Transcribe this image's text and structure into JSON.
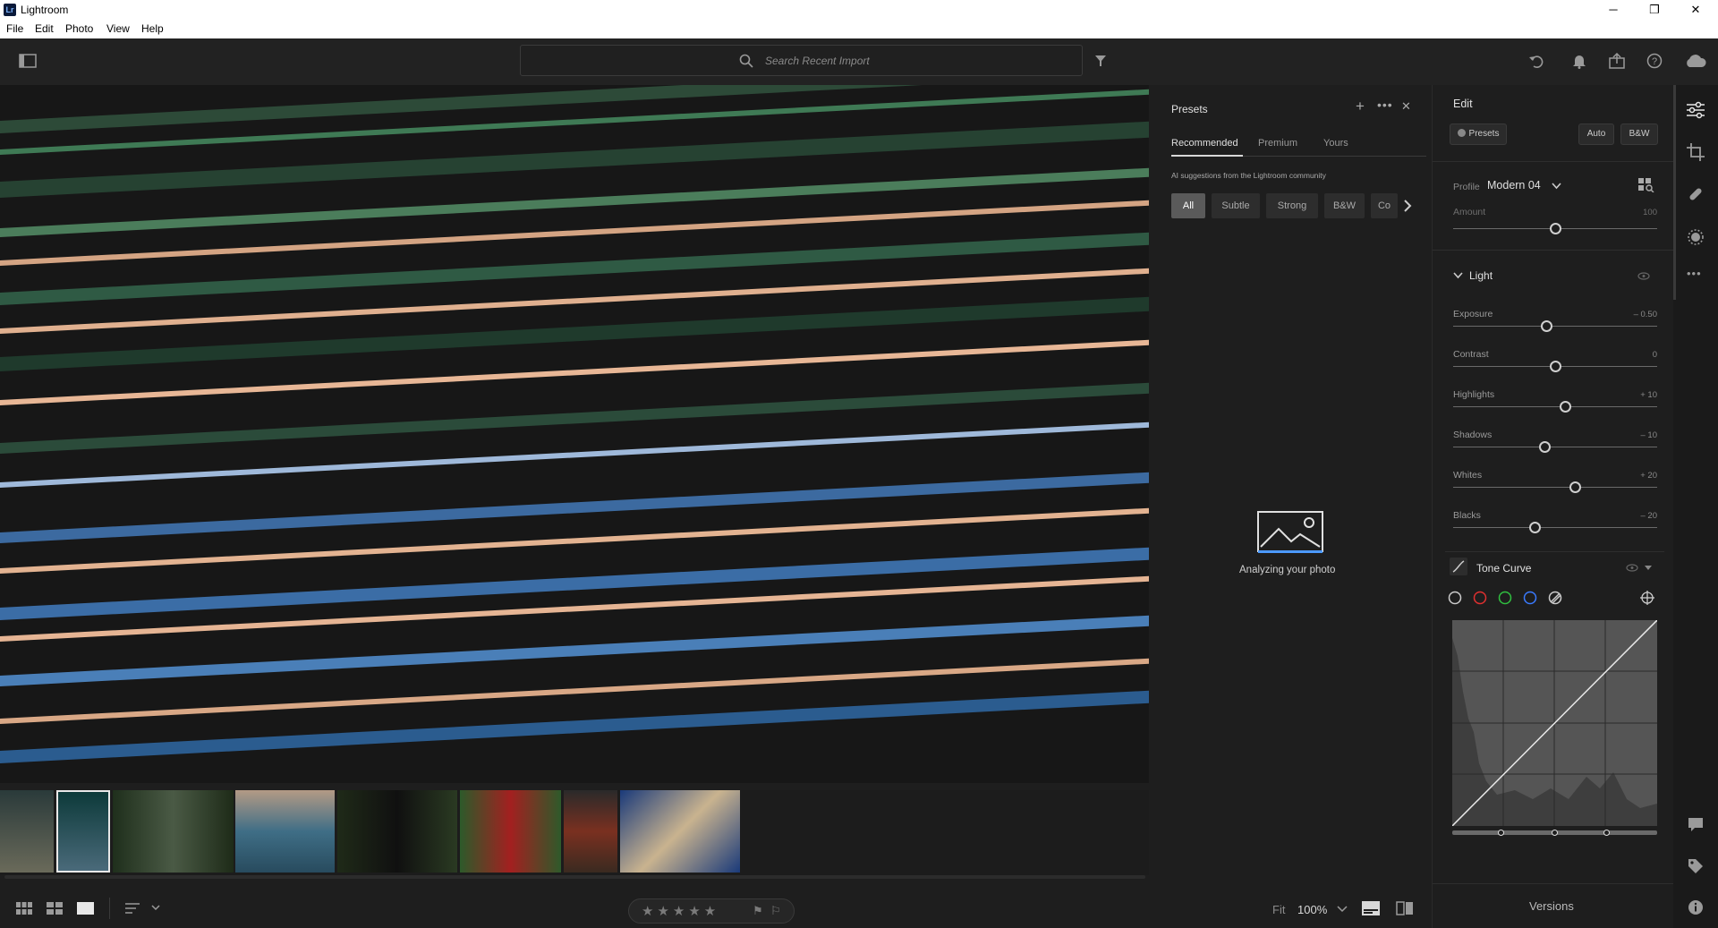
{
  "window": {
    "app_name": "Lightroom",
    "logo_text": "Lr",
    "minimize": "─",
    "maximize": "❐",
    "close": "✕"
  },
  "menu": [
    "File",
    "Edit",
    "Photo",
    "View",
    "Help"
  ],
  "search": {
    "placeholder": "Search Recent Import"
  },
  "presets_panel": {
    "title": "Presets",
    "tabs": [
      "Recommended",
      "Premium",
      "Yours"
    ],
    "active_tab": "Recommended",
    "subtitle": "AI suggestions from the Lightroom community",
    "filters": [
      "All",
      "Subtle",
      "Strong",
      "B&W",
      "Co"
    ],
    "status": "Analyzing your photo"
  },
  "edit_panel": {
    "title": "Edit",
    "presets_button": "Presets",
    "auto_button": "Auto",
    "bw_button": "B&W",
    "profile_label": "Profile",
    "profile_value": "Modern 04",
    "amount_label": "Amount",
    "amount_value": "100",
    "light_title": "Light",
    "sliders": [
      {
        "label": "Exposure",
        "value": "– 0.50",
        "pos": 0.46
      },
      {
        "label": "Contrast",
        "value": "0",
        "pos": 0.5
      },
      {
        "label": "Highlights",
        "value": "+ 10",
        "pos": 0.55
      },
      {
        "label": "Shadows",
        "value": "– 10",
        "pos": 0.45
      },
      {
        "label": "Whites",
        "value": "+ 20",
        "pos": 0.6
      },
      {
        "label": "Blacks",
        "value": "– 20",
        "pos": 0.4
      }
    ],
    "amount_pos": 0.5,
    "tone_curve_title": "Tone Curve"
  },
  "bottom": {
    "fit_label": "Fit",
    "zoom": "100%",
    "versions": "Versions"
  },
  "colors": {
    "accent": "#4c9aff",
    "panel": "#1e1e1e",
    "dark": "#161616"
  }
}
